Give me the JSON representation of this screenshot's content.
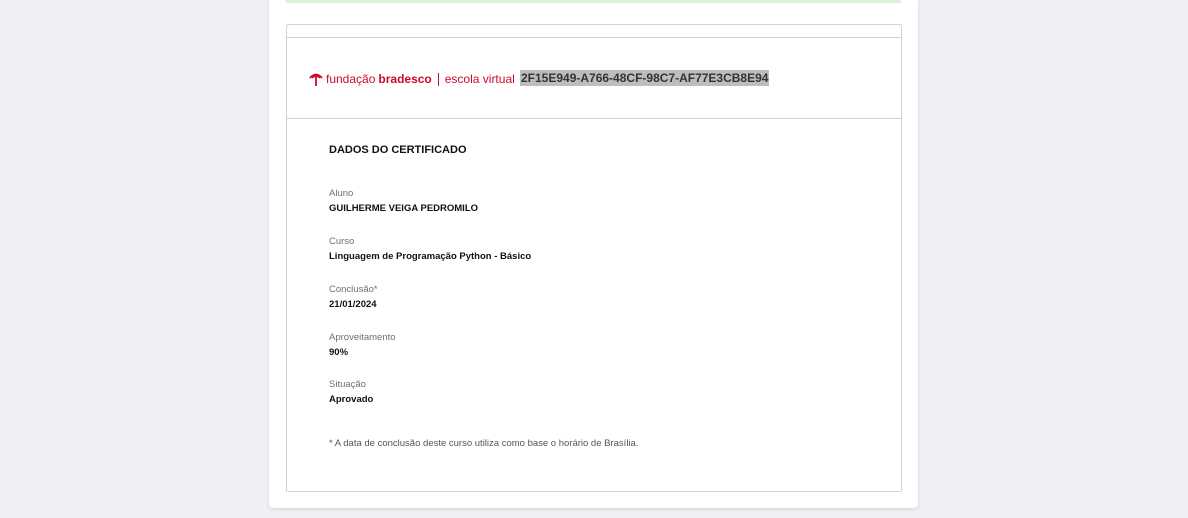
{
  "logo": {
    "fundacao": "fundação",
    "bradesco": "bradesco",
    "escola_virtual": "escola virtual"
  },
  "certificate": {
    "code": "2F15E949-A766-48CF-98C7-AF77E3CB8E94",
    "section_title": "DADOS DO CERTIFICADO",
    "fields": [
      {
        "label": "Aluno",
        "value": "GUILHERME VEIGA PEDROMILO"
      },
      {
        "label": "Curso",
        "value": "Linguagem de Programação Python - Básico"
      },
      {
        "label": "Conclusão*",
        "value": "21/01/2024"
      },
      {
        "label": "Aproveitamento",
        "value": "90%"
      },
      {
        "label": "Situação",
        "value": "Aprovado"
      }
    ],
    "footnote": "* A data de conclusão deste curso utiliza como base o horário de Brasília."
  },
  "colors": {
    "brand": "#cc092f",
    "success_strip": "#d5f5d6",
    "code_highlight": "#bdbdbd"
  }
}
